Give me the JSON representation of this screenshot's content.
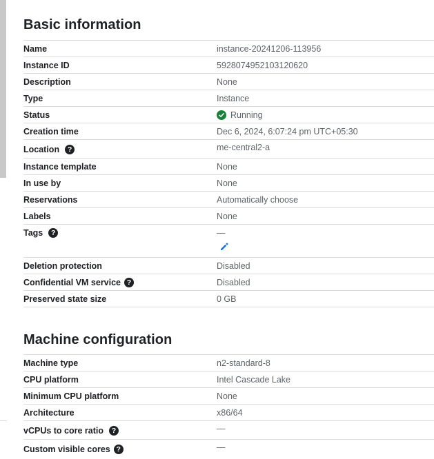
{
  "basic_information": {
    "title": "Basic information",
    "rows": [
      {
        "label": "Name",
        "value": "instance-20241206-113956"
      },
      {
        "label": "Instance ID",
        "value": "5928074952103120620"
      },
      {
        "label": "Description",
        "value": "None"
      },
      {
        "label": "Type",
        "value": "Instance"
      },
      {
        "label": "Status",
        "value": "Running"
      },
      {
        "label": "Creation time",
        "value": "Dec 6, 2024, 6:07:24 pm UTC+05:30"
      },
      {
        "label": "Location",
        "value": "me-central2-a"
      },
      {
        "label": "Instance template",
        "value": "None"
      },
      {
        "label": "In use by",
        "value": "None"
      },
      {
        "label": "Reservations",
        "value": "Automatically choose"
      },
      {
        "label": "Labels",
        "value": "None"
      },
      {
        "label": "Tags",
        "value": "—"
      },
      {
        "label": "Deletion protection",
        "value": "Disabled"
      },
      {
        "label": "Confidential VM service",
        "value": "Disabled"
      },
      {
        "label": "Preserved state size",
        "value": "0 GB"
      }
    ]
  },
  "machine_configuration": {
    "title": "Machine configuration",
    "rows": [
      {
        "label": "Machine type",
        "value": "n2-standard-8"
      },
      {
        "label": "CPU platform",
        "value": "Intel Cascade Lake"
      },
      {
        "label": "Minimum CPU platform",
        "value": "None"
      },
      {
        "label": "Architecture",
        "value": "x86/64"
      },
      {
        "label": "vCPUs to core ratio",
        "value": "—"
      },
      {
        "label": "Custom visible cores",
        "value": "—"
      }
    ]
  },
  "icons": {
    "help": "help-circle-icon",
    "status": "check-circle-icon",
    "edit": "pencil-edit-icon"
  },
  "colors": {
    "status_green": "#188038",
    "edit_blue": "#1a73e8",
    "value_gray": "#5f6368"
  }
}
